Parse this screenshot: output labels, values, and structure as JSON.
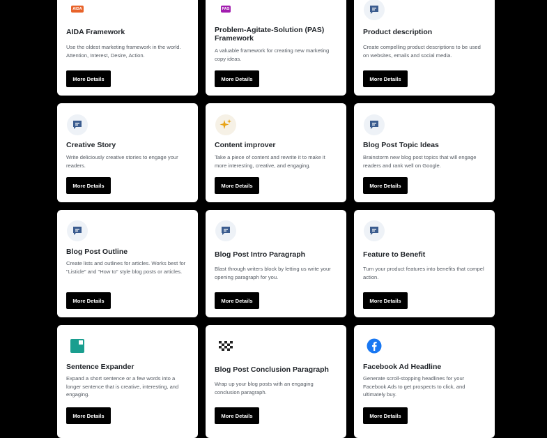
{
  "cards": [
    {
      "title": "AIDA Framework",
      "description": "Use the oldest marketing framework in the world. Attention, Interest, Desire, Action.",
      "button": "More Details",
      "icon": "aida-icon",
      "badge": "AIDA"
    },
    {
      "title": "Problem-Agitate-Solution (PAS) Framework",
      "description": "A valuable framework for creating new marketing copy ideas.",
      "button": "More Details",
      "icon": "pas-icon",
      "badge": "PAS"
    },
    {
      "title": "Product description",
      "description": "Create compelling product descriptions to be used on websites, emails and social media.",
      "button": "More Details",
      "icon": "chat-icon"
    },
    {
      "title": "Creative Story",
      "description": "Write deliciously creative stories to engage your readers.",
      "button": "More Details",
      "icon": "chat-icon"
    },
    {
      "title": "Content improver",
      "description": "Take a piece of content and rewrite it to make it more interesting, creative, and engaging.",
      "button": "More Details",
      "icon": "sparkles-icon"
    },
    {
      "title": "Blog Post Topic Ideas",
      "description": "Brainstorm new blog post topics that will engage readers and rank well on Google.",
      "button": "More Details",
      "icon": "chat-icon"
    },
    {
      "title": "Blog Post Outline",
      "description": "Create lists and outlines for articles. Works best for \"Listicle\" and \"How to\" style blog posts or articles.",
      "button": "More Details",
      "icon": "chat-icon"
    },
    {
      "title": "Blog Post Intro Paragraph",
      "description": "Blast through writers block by letting us write your opening paragraph for you.",
      "button": "More Details",
      "icon": "chat-icon"
    },
    {
      "title": "Feature to Benefit",
      "description": "Turn your product features into benefits that compel action.",
      "button": "More Details",
      "icon": "chat-icon"
    },
    {
      "title": "Sentence Expander",
      "description": "Expand a short sentence or a few words into a longer sentence that is creative, interesting, and engaging.",
      "button": "More Details",
      "icon": "expand-icon"
    },
    {
      "title": "Blog Post Conclusion Paragraph",
      "description": "Wrap up your blog posts with an engaging conclusion paragraph.",
      "button": "More Details",
      "icon": "checkered-flag-icon"
    },
    {
      "title": "Facebook Ad Headline",
      "description": "Generate scroll-stopping headlines for your Facebook Ads to get prospects to click, and ultimately buy.",
      "button": "More Details",
      "icon": "facebook-icon"
    }
  ]
}
